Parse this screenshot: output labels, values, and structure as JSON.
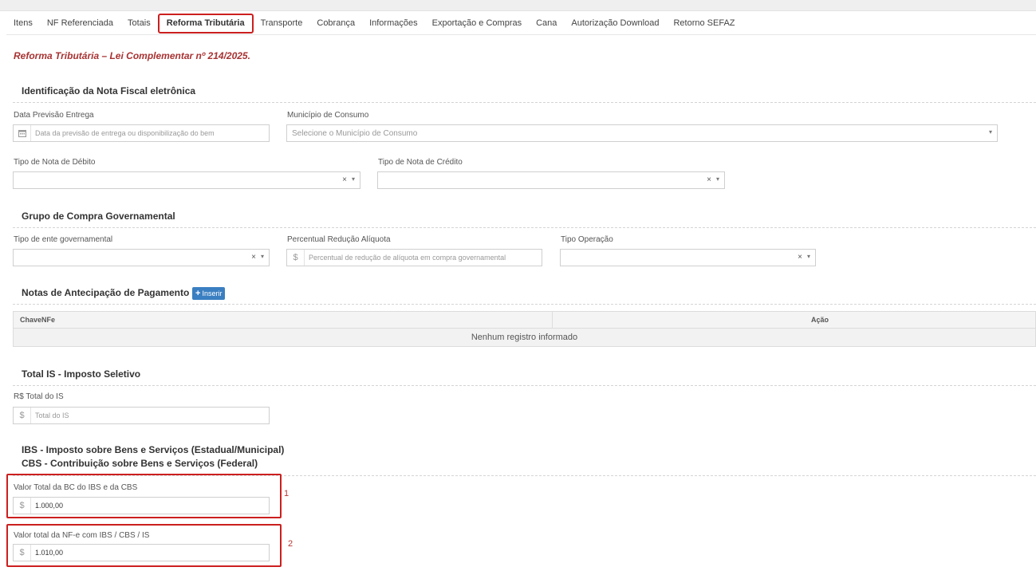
{
  "tabs": [
    "Itens",
    "NF Referenciada",
    "Totais",
    "Reforma Tributária",
    "Transporte",
    "Cobrança",
    "Informações",
    "Exportação e Compras",
    "Cana",
    "Autorização Download",
    "Retorno SEFAZ"
  ],
  "active_tab": "Reforma Tributária",
  "subtitle": "Reforma Tributária – Lei Complementar nº 214/2025.",
  "sections": {
    "identificacao": {
      "title": "Identificação da Nota Fiscal eletrônica",
      "data_previsao_label": "Data Previsão Entrega",
      "data_previsao_placeholder": "Data da previsão de entrega ou disponibilização do bem",
      "municipio_label": "Município de Consumo",
      "municipio_placeholder": "Selecione o Município de Consumo",
      "tipo_debito_label": "Tipo de Nota de Débito",
      "tipo_credito_label": "Tipo de Nota de Crédito"
    },
    "compra_gov": {
      "title": "Grupo de Compra Governamental",
      "ente_label": "Tipo de ente governamental",
      "percentual_label": "Percentual Redução Alíquota",
      "percentual_placeholder": "Percentual de redução de alíquota em compra governamental",
      "tipo_operacao_label": "Tipo Operação"
    },
    "antecipacao": {
      "title": "Notas de Antecipação de Pagamento",
      "insert_label": "Inserir",
      "columns": [
        "ChaveNFe",
        "Ação"
      ],
      "empty_text": "Nenhum registro informado"
    },
    "total_is": {
      "title": "Total IS - Imposto Seletivo",
      "total_label": "R$ Total do IS",
      "total_placeholder": "Total do IS"
    },
    "ibs_cbs": {
      "title_line1": "IBS - Imposto sobre Bens e Serviços (Estadual/Municipal)",
      "title_line2": "CBS - Contribuição sobre Bens e Serviços (Federal)",
      "bc_label": "Valor Total da BC do IBS e da CBS",
      "bc_value": "1.000,00",
      "nfe_total_label": "Valor total da NF-e com IBS / CBS / IS",
      "nfe_total_value": "1.010,00"
    }
  },
  "markers": [
    "1",
    "2"
  ],
  "icons": {
    "currency": "$",
    "calendar": "calendar-icon",
    "clear": "×",
    "dropdown": "▾"
  },
  "colors": {
    "highlight": "#cc1f1f",
    "subtitle": "#a83232",
    "insert_button": "#3a7fc1"
  }
}
